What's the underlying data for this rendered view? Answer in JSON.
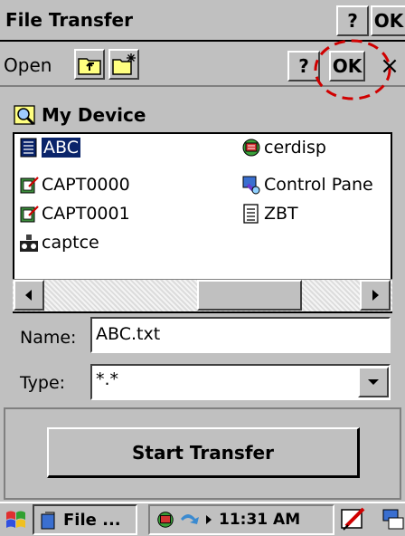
{
  "title_bar": {
    "title": "File Transfer",
    "help_label": "?",
    "ok_label": "OK"
  },
  "dialog": {
    "open_label": "Open",
    "help_label": "?",
    "ok_label": "OK",
    "close_label": "×"
  },
  "location": {
    "label": "My Device"
  },
  "files": [
    {
      "name": "ABC",
      "icon": "folder-icon",
      "selected": true
    },
    {
      "name": "CAPT0000",
      "icon": "capture-file-icon"
    },
    {
      "name": "CAPT0001",
      "icon": "capture-file-icon"
    },
    {
      "name": "captce",
      "icon": "executable-icon"
    },
    {
      "name": "cerdisp",
      "icon": "network-icon"
    },
    {
      "name": "Control Pane",
      "icon": "control-panel-icon"
    },
    {
      "name": "ZBT",
      "icon": "document-icon"
    }
  ],
  "name_field": {
    "label": "Name:",
    "value": "ABC.txt"
  },
  "type_field": {
    "label": "Type:",
    "value": "*.*"
  },
  "start_button": {
    "label": "Start Transfer"
  },
  "taskbar": {
    "task_label": "File ...",
    "time": "11:31 AM"
  },
  "colors": {
    "highlight": "#0a246a",
    "annotation": "#d00000"
  }
}
